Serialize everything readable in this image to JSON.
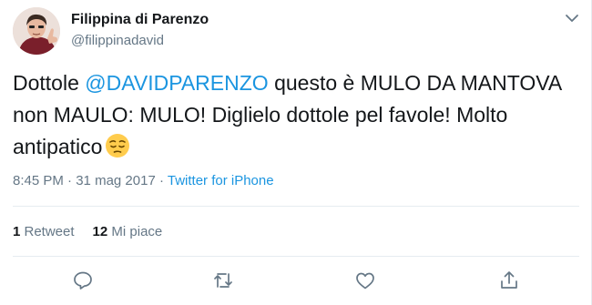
{
  "user": {
    "display_name": "Filippina di Parenzo",
    "handle": "@filippinadavid"
  },
  "tweet": {
    "text_before": "Dottole ",
    "mention": "@DAVIDPARENZO",
    "text_after": " questo è MULO DA MANTOVA non MAULO: MULO! Diglielo dottole pel favole! Molto antipatico",
    "emoji": "pensive-face-emoji"
  },
  "meta": {
    "time": "8:45 PM",
    "separator": " · ",
    "date": "31 mag 2017",
    "source": "Twitter for iPhone"
  },
  "stats": {
    "retweets_count": "1",
    "retweets_label": " Retweet",
    "likes_count": "12",
    "likes_label": " Mi piace"
  },
  "actions": [
    "reply-icon",
    "retweet-icon",
    "like-icon",
    "share-icon"
  ],
  "colors": {
    "link": "#1b95e0",
    "secondary_text": "#657786",
    "primary_text": "#14171a",
    "divider": "#e6ecf0"
  }
}
